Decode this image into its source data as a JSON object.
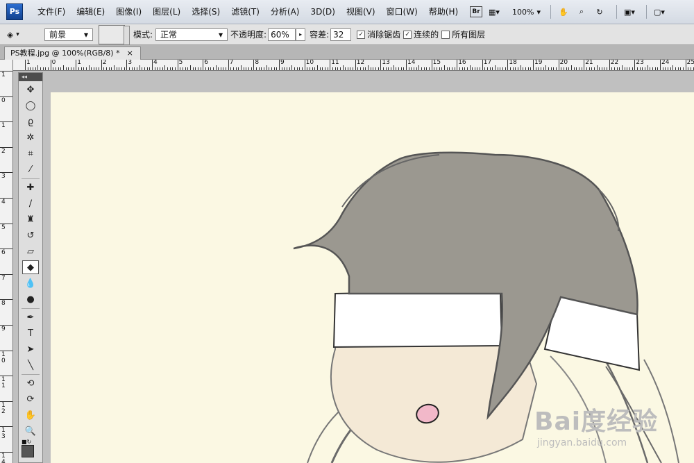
{
  "app": {
    "logo_text": "Ps"
  },
  "menu": {
    "items": [
      "文件(F)",
      "编辑(E)",
      "图像(I)",
      "图层(L)",
      "选择(S)",
      "滤镜(T)",
      "分析(A)",
      "3D(D)",
      "视图(V)",
      "窗口(W)",
      "帮助(H)"
    ]
  },
  "app_bar": {
    "bridge_label": "Br",
    "zoom_value": "100%"
  },
  "options": {
    "fill_source": "前景",
    "mode_label": "模式:",
    "mode_value": "正常",
    "opacity_label": "不透明度:",
    "opacity_value": "60%",
    "tolerance_label": "容差:",
    "tolerance_value": "32",
    "antialias_label": "消除锯齿",
    "antialias_checked": true,
    "contiguous_label": "连续的",
    "contiguous_checked": true,
    "all_layers_label": "所有图层",
    "all_layers_checked": false
  },
  "document": {
    "tab_title": "PS教程.jpg @ 100%(RGB/8) *",
    "close_glyph": "×"
  },
  "rulers": {
    "horizontal": [
      "1",
      "0",
      "1",
      "2",
      "3",
      "4",
      "5",
      "6",
      "7",
      "8",
      "9",
      "10",
      "11",
      "12",
      "13",
      "14",
      "15",
      "16",
      "17",
      "18",
      "19",
      "20",
      "21",
      "22",
      "23",
      "24",
      "25"
    ],
    "vertical": [
      "1",
      "0",
      "1",
      "2",
      "3",
      "4",
      "5",
      "6",
      "7",
      "8",
      "9",
      "1 0",
      "1 1",
      "1 2",
      "1 3",
      "1 4"
    ]
  },
  "toolbox": {
    "collapse_glyph": "◂◂",
    "tools": [
      {
        "name": "move-tool-icon",
        "glyph": "✥"
      },
      {
        "name": "marquee-tool-icon",
        "glyph": "◯"
      },
      {
        "name": "lasso-tool-icon",
        "glyph": "ϱ"
      },
      {
        "name": "magic-wand-tool-icon",
        "glyph": "✲"
      },
      {
        "name": "crop-tool-icon",
        "glyph": "⌗"
      },
      {
        "name": "eyedropper-tool-icon",
        "glyph": "⁄"
      },
      {
        "name": "healing-brush-tool-icon",
        "glyph": "✚"
      },
      {
        "name": "brush-tool-icon",
        "glyph": "∕"
      },
      {
        "name": "clone-stamp-tool-icon",
        "glyph": "♜"
      },
      {
        "name": "history-brush-tool-icon",
        "glyph": "↺"
      },
      {
        "name": "eraser-tool-icon",
        "glyph": "▱"
      },
      {
        "name": "paint-bucket-tool-icon",
        "glyph": "◆"
      },
      {
        "name": "blur-tool-icon",
        "glyph": "💧"
      },
      {
        "name": "dodge-tool-icon",
        "glyph": "●"
      },
      {
        "name": "pen-tool-icon",
        "glyph": "✒"
      },
      {
        "name": "type-tool-icon",
        "glyph": "T"
      },
      {
        "name": "path-selection-tool-icon",
        "glyph": "➤"
      },
      {
        "name": "line-tool-icon",
        "glyph": "╲"
      },
      {
        "name": "3d-rotate-tool-icon",
        "glyph": "⟲"
      },
      {
        "name": "3d-orbit-tool-icon",
        "glyph": "⟳"
      },
      {
        "name": "hand-tool-icon",
        "glyph": "✋"
      },
      {
        "name": "zoom-tool-icon",
        "glyph": "🔍"
      }
    ]
  },
  "colors": {
    "canvas_bg": "#fbf8e3",
    "hair": "#9b9890",
    "headband": "#ffffff",
    "skin": "#f4e9d6",
    "nose": "#f2b8c9",
    "outline": "#555555"
  },
  "watermark": {
    "main": "Bai度经验",
    "sub": "jingyan.baidu.com"
  }
}
